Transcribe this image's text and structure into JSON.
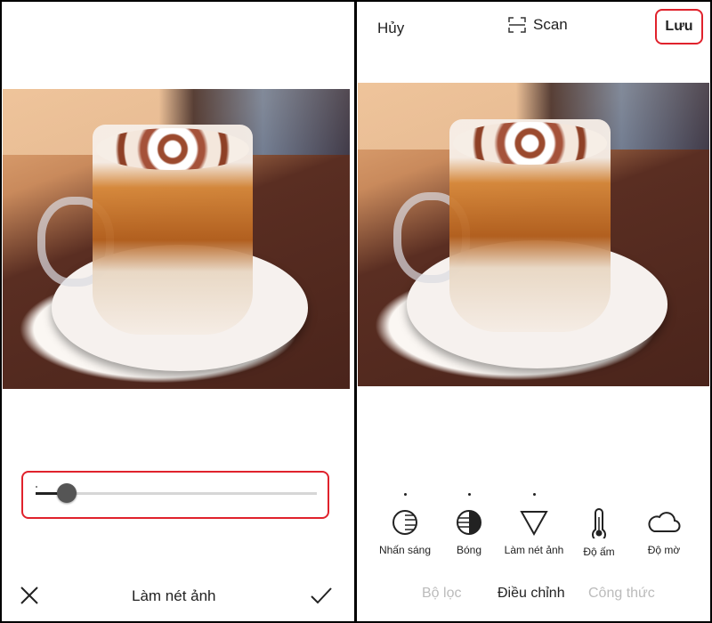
{
  "left_panel": {
    "slider": {
      "value_percent": 11
    },
    "footer": {
      "close_icon": "close-icon",
      "title": "Làm nét ảnh",
      "confirm_icon": "check-icon"
    }
  },
  "right_panel": {
    "header": {
      "cancel": "Hủy",
      "scan": "Scan",
      "scan_icon": "scan-icon",
      "save": "Lưu"
    },
    "tools": [
      {
        "label": "Nhấn sáng",
        "icon": "highlight-icon",
        "adjusted": true
      },
      {
        "label": "Bóng",
        "icon": "shadow-icon",
        "adjusted": true
      },
      {
        "label": "Làm nét ảnh",
        "icon": "sharpen-icon",
        "adjusted": true
      },
      {
        "label": "Độ ấm",
        "icon": "thermometer-icon",
        "adjusted": false
      },
      {
        "label": "Độ mờ",
        "icon": "cloud-icon",
        "adjusted": false
      }
    ],
    "tabs": [
      {
        "label": "Bộ lọc",
        "active": false
      },
      {
        "label": "Điều chỉnh",
        "active": true
      },
      {
        "label": "Công thức",
        "active": false
      }
    ]
  },
  "colors": {
    "highlight_border": "#e0222c",
    "inactive_tab": "#bbbbbb"
  }
}
